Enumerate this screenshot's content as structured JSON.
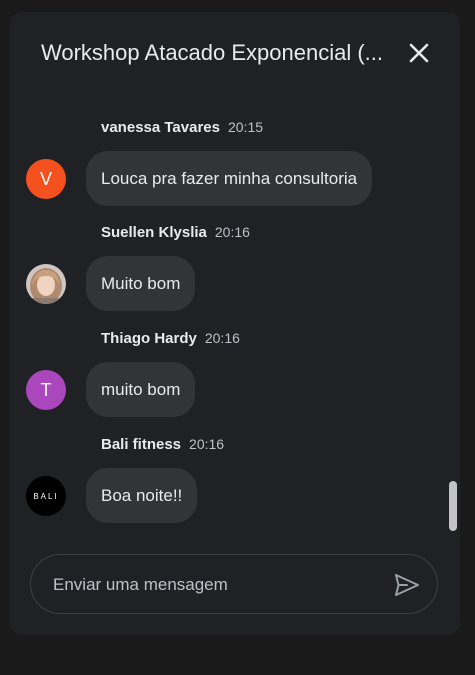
{
  "header": {
    "title": "Workshop Atacado Exponencial (...",
    "close_icon": "close-icon"
  },
  "messages": [
    {
      "author": "vanessa Tavares",
      "time": "20:15",
      "text": "Louca pra fazer minha consultoria",
      "avatar_letter": "V",
      "avatar_color": "#f4511e"
    },
    {
      "author": "Suellen Klyslia",
      "time": "20:16",
      "text": "Muito bom",
      "avatar_letter": "",
      "avatar_color": "#d9b8a3"
    },
    {
      "author": "Thiago Hardy",
      "time": "20:16",
      "text": "muito bom",
      "avatar_letter": "T",
      "avatar_color": "#ab47bc"
    },
    {
      "author": "Bali fitness",
      "time": "20:16",
      "text": "Boa noite!!",
      "avatar_letter": "BALI",
      "avatar_color": "#000000"
    }
  ],
  "composer": {
    "placeholder": "Enviar uma mensagem",
    "value": "",
    "send_icon": "send-icon"
  },
  "colors": {
    "background": "#1a1a1b",
    "panel": "#202124",
    "bubble": "#333437",
    "text": "#e8eaed"
  }
}
